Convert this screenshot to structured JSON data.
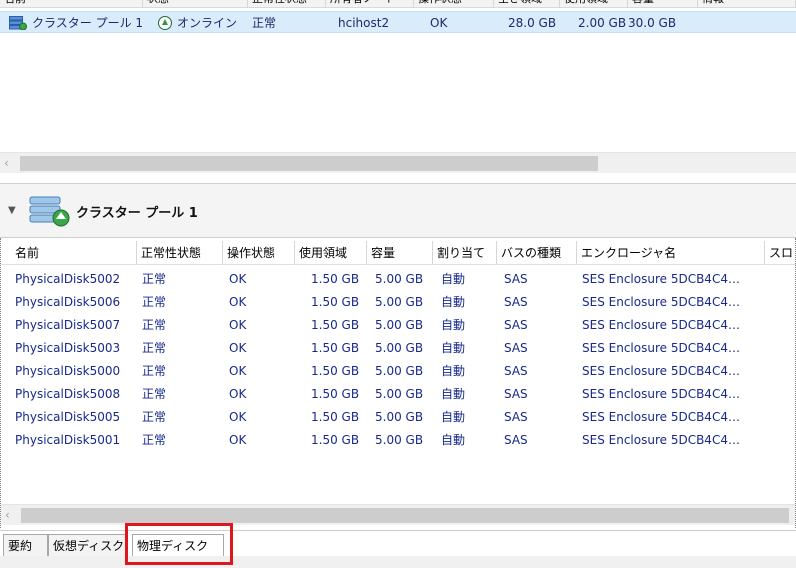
{
  "top_table": {
    "columns": [
      "名前",
      "状態",
      "正常性状態",
      "所有者ノード",
      "操作状態",
      "空き領域",
      "使用領域",
      "容量",
      "情報"
    ],
    "row": {
      "name": "クラスター プール 1",
      "status": "オンライン",
      "health": "正常",
      "owner": "hcihost2",
      "op_status": "OK",
      "free": "28.0 GB",
      "used": "2.00 GB",
      "capacity": "30.0 GB"
    }
  },
  "detail": {
    "title": "クラスター プール 1"
  },
  "disk_table": {
    "columns": [
      "名前",
      "正常性状態",
      "操作状態",
      "使用領域",
      "容量",
      "割り当て",
      "バスの種類",
      "エンクロージャ名",
      "スロ"
    ],
    "rows": [
      {
        "name": "PhysicalDisk5002",
        "health": "正常",
        "op": "OK",
        "used": "1.50 GB",
        "cap": "5.00 GB",
        "alloc": "自動",
        "bus": "SAS",
        "enclosure": "SES Enclosure 5DCB4C4…"
      },
      {
        "name": "PhysicalDisk5006",
        "health": "正常",
        "op": "OK",
        "used": "1.50 GB",
        "cap": "5.00 GB",
        "alloc": "自動",
        "bus": "SAS",
        "enclosure": "SES Enclosure 5DCB4C4…"
      },
      {
        "name": "PhysicalDisk5007",
        "health": "正常",
        "op": "OK",
        "used": "1.50 GB",
        "cap": "5.00 GB",
        "alloc": "自動",
        "bus": "SAS",
        "enclosure": "SES Enclosure 5DCB4C4…"
      },
      {
        "name": "PhysicalDisk5003",
        "health": "正常",
        "op": "OK",
        "used": "1.50 GB",
        "cap": "5.00 GB",
        "alloc": "自動",
        "bus": "SAS",
        "enclosure": "SES Enclosure 5DCB4C4…"
      },
      {
        "name": "PhysicalDisk5000",
        "health": "正常",
        "op": "OK",
        "used": "1.50 GB",
        "cap": "5.00 GB",
        "alloc": "自動",
        "bus": "SAS",
        "enclosure": "SES Enclosure 5DCB4C4…"
      },
      {
        "name": "PhysicalDisk5008",
        "health": "正常",
        "op": "OK",
        "used": "1.50 GB",
        "cap": "5.00 GB",
        "alloc": "自動",
        "bus": "SAS",
        "enclosure": "SES Enclosure 5DCB4C4…"
      },
      {
        "name": "PhysicalDisk5005",
        "health": "正常",
        "op": "OK",
        "used": "1.50 GB",
        "cap": "5.00 GB",
        "alloc": "自動",
        "bus": "SAS",
        "enclosure": "SES Enclosure 5DCB4C4…"
      },
      {
        "name": "PhysicalDisk5001",
        "health": "正常",
        "op": "OK",
        "used": "1.50 GB",
        "cap": "5.00 GB",
        "alloc": "自動",
        "bus": "SAS",
        "enclosure": "SES Enclosure 5DCB4C4…"
      }
    ]
  },
  "tabs": [
    "要約",
    "仮想ディスク",
    "物理ディスク"
  ],
  "active_tab": "物理ディスク",
  "colors": {
    "selection": "#d9ecfb",
    "link_text": "#17298c",
    "highlight_box": "#e0161f"
  }
}
